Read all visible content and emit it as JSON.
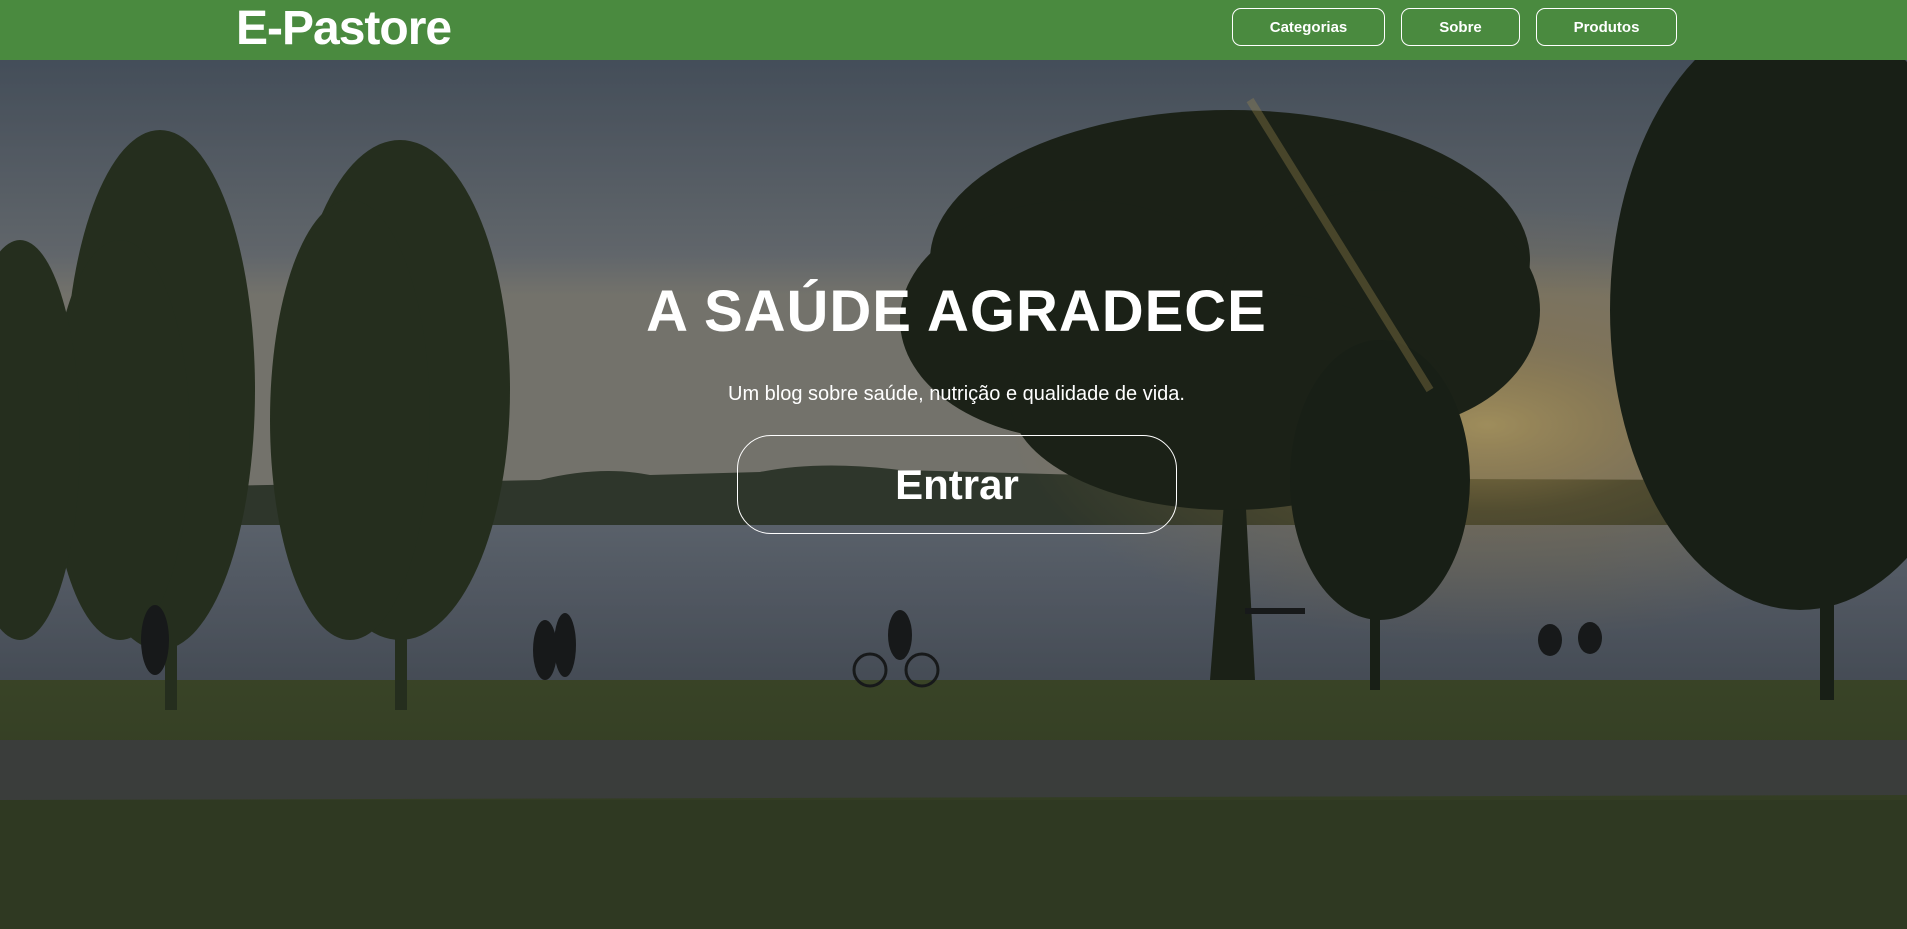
{
  "header": {
    "brand": "E-Pastore",
    "nav": [
      {
        "label": "Categorias"
      },
      {
        "label": "Sobre"
      },
      {
        "label": "Produtos"
      }
    ],
    "background_color": "#4a8a3f"
  },
  "hero": {
    "title": "A SAÚDE AGRADECE",
    "subtitle": "Um blog sobre saúde, nutrição e qualidade de vida.",
    "cta_label": "Entrar",
    "background_image": "park-lakeside-sunset"
  }
}
